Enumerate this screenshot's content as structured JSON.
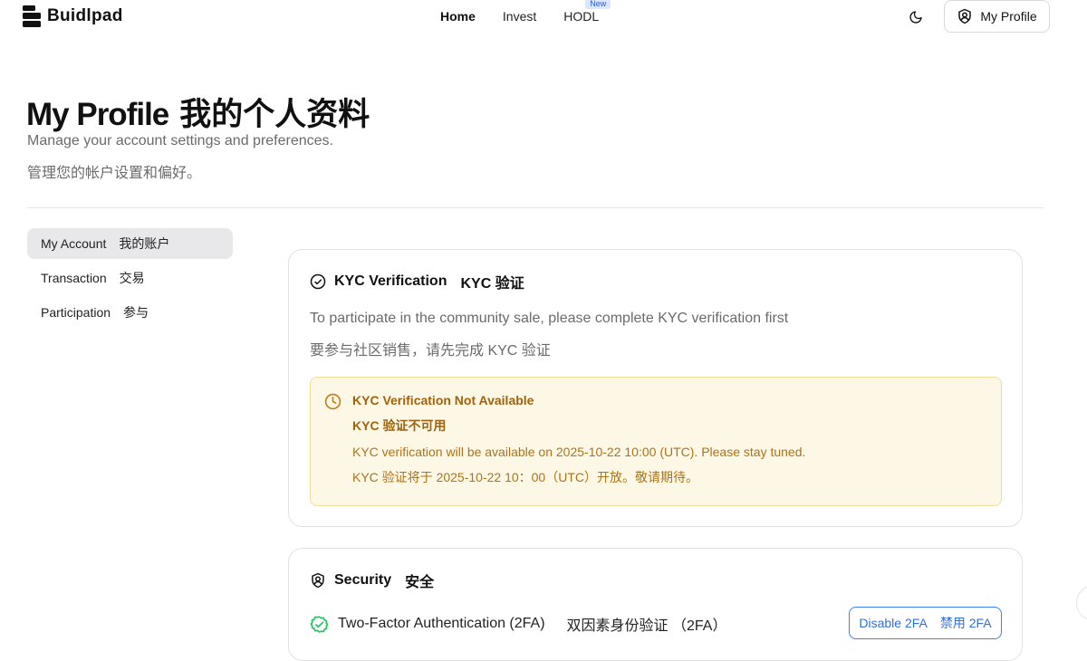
{
  "header": {
    "logo_text": "Buidlpad",
    "nav": [
      {
        "label": "Home"
      },
      {
        "label": "Invest"
      },
      {
        "label": "HODL",
        "badge": "New"
      }
    ],
    "theme_icon": "moon-icon",
    "profile_button": "My Profile"
  },
  "page": {
    "title_en": "My Profile",
    "title_zh": "我的个人资料",
    "subtitle_en": "Manage your account settings and preferences.",
    "subtitle_zh": "管理您的帐户设置和偏好。"
  },
  "sidebar": {
    "items": [
      {
        "label_en": "My Account",
        "label_zh": "我的账户",
        "active": true
      },
      {
        "label_en": "Transaction",
        "label_zh": "交易",
        "active": false
      },
      {
        "label_en": "Participation",
        "label_zh": "参与",
        "active": false
      }
    ]
  },
  "kyc": {
    "title_en": "KYC Verification",
    "title_zh": "KYC 验证",
    "desc_en": "To participate in the community sale, please complete KYC verification first",
    "desc_zh": "要参与社区销售，请先完成 KYC 验证",
    "notice": {
      "title_en": "KYC Verification Not Available",
      "title_zh": "KYC 验证不可用",
      "body_en": "KYC verification will be available on 2025-10-22 10:00 (UTC). Please stay tuned.",
      "body_zh": "KYC 验证将于 2025-10-22 10：00（UTC）开放。敬请期待。"
    }
  },
  "security": {
    "title_en": "Security",
    "title_zh": "安全",
    "twofa_en": "Two-Factor Authentication (2FA)",
    "twofa_zh": "双因素身份验证 （2FA）",
    "disable_en": "Disable 2FA",
    "disable_zh": "禁用 2FA"
  },
  "colors": {
    "notice_bg": "#fdf8e6",
    "notice_text": "#a0620c",
    "success_green": "#22c55e",
    "button_blue": "#2f6fe0"
  }
}
